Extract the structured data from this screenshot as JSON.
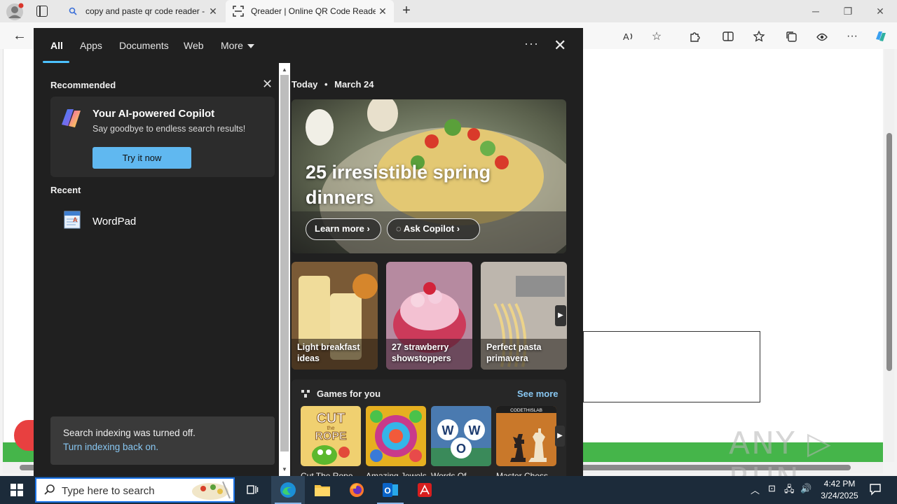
{
  "browser": {
    "tabs": [
      {
        "label": "copy and paste qr code reader - Search",
        "icon": "search-icon"
      },
      {
        "label": "Qreader | Online QR Code Reader",
        "icon": "qr-scan-icon"
      }
    ],
    "window_controls": {
      "minimize": "─",
      "restore": "❐",
      "close": "✕"
    }
  },
  "search_panel": {
    "tabs": [
      {
        "label": "All",
        "active": true
      },
      {
        "label": "Apps"
      },
      {
        "label": "Documents"
      },
      {
        "label": "Web"
      },
      {
        "label": "More"
      }
    ],
    "recommended": {
      "heading": "Recommended",
      "card_title": "Your AI-powered Copilot",
      "card_subtitle": "Say goodbye to endless search results!",
      "card_button": "Try it now"
    },
    "recent": {
      "heading": "Recent",
      "items": [
        {
          "label": "WordPad"
        }
      ]
    },
    "indexing": {
      "message": "Search indexing was turned off.",
      "link": "Turn indexing back on."
    },
    "today": {
      "label": "Today",
      "separator": "•",
      "date": "March 24"
    },
    "hero": {
      "title": "25 irresistible spring dinners",
      "learn_more": "Learn more",
      "ask_copilot": "Ask Copilot"
    },
    "cards": [
      {
        "label": "Light breakfast ideas"
      },
      {
        "label": "27 strawberry showstoppers"
      },
      {
        "label": "Perfect pasta primavera"
      }
    ],
    "games": {
      "heading": "Games for you",
      "see_more": "See more",
      "items": [
        {
          "label": "Cut The Rope"
        },
        {
          "label": "Amazing Jewels"
        },
        {
          "label": "Words Of"
        },
        {
          "label": "Master Chess"
        }
      ],
      "game_art_text": {
        "cut": "CUT",
        "the": "the",
        "rope": "ROPE",
        "w": "W",
        "o": "O",
        "codethislab": "CODETHISLAB"
      }
    }
  },
  "taskbar": {
    "search_placeholder": "Type here to search",
    "time": "4:42 PM",
    "date": "3/24/2025"
  },
  "watermark": "ANY ▷ RUN",
  "colors": {
    "accent": "#4cc2ff",
    "panel_bg": "#202020",
    "link": "#88c7f2",
    "button_blue": "#60b8f0",
    "green_bar": "#45b54a"
  }
}
